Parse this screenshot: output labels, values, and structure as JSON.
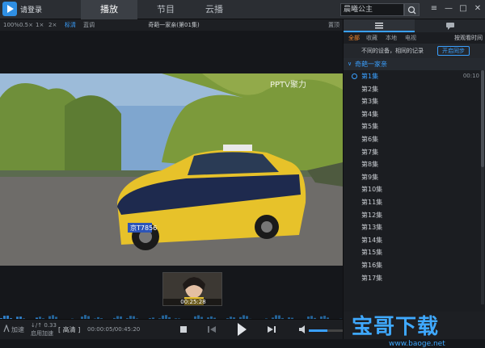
{
  "app": {
    "login_label": "请登录",
    "tabs": [
      {
        "label": "播放"
      },
      {
        "label": "节目"
      },
      {
        "label": "云播"
      }
    ],
    "search_value": "晨曦公主",
    "window_controls": [
      "≡",
      "—",
      "□",
      "✕"
    ]
  },
  "player": {
    "speeds": [
      "100%",
      "0.5×",
      "1×",
      "2×",
      "标清",
      "蓝调"
    ],
    "title": "奇葩一家亲(第01集)",
    "playlist_label": "置顶",
    "watermark": "PPTV聚力",
    "plate": "京T7856",
    "thumb_time": "00:25:28",
    "progress": 0.11
  },
  "bottom": {
    "speed_label": "加速",
    "speed_val": "↓/↑ 0.33",
    "speed_sub": "启用加速",
    "quality": "高清",
    "time": "00:00:05/00:45:20",
    "volume": 0.55
  },
  "panel": {
    "filters": [
      "全部",
      "收藏",
      "本地",
      "电视"
    ],
    "sort_label": "按观看时间",
    "sync_text": "不同的设备，相同的记录",
    "sync_btn": "开启同步",
    "series": "奇葩一家亲",
    "episodes": [
      {
        "label": "第1集",
        "dur": "00:10"
      },
      {
        "label": "第2集"
      },
      {
        "label": "第3集"
      },
      {
        "label": "第4集"
      },
      {
        "label": "第5集"
      },
      {
        "label": "第6集"
      },
      {
        "label": "第7集"
      },
      {
        "label": "第8集"
      },
      {
        "label": "第9集"
      },
      {
        "label": "第10集"
      },
      {
        "label": "第11集"
      },
      {
        "label": "第12集"
      },
      {
        "label": "第13集"
      },
      {
        "label": "第14集"
      },
      {
        "label": "第15集"
      },
      {
        "label": "第16集"
      },
      {
        "label": "第17集"
      }
    ]
  },
  "watermark_brand": {
    "text": "宝哥下载",
    "url": "www.baoge.net"
  },
  "colors": {
    "accent": "#3aa0ff",
    "filter_on": "#ff8a2a"
  }
}
